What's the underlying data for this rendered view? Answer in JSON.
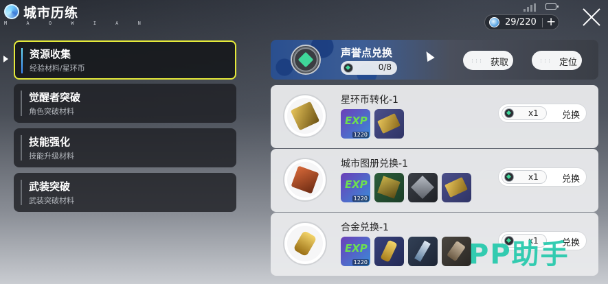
{
  "header": {
    "title": "城市历练",
    "subtitle": "M A O W I A N",
    "currency": {
      "icon": "gem-icon",
      "value": "29/220",
      "plus": "+"
    }
  },
  "menu": {
    "items": [
      {
        "label": "资源收集",
        "sub": "经验材料/星环币",
        "active": true
      },
      {
        "label": "觉醒者突破",
        "sub": "角色突破材料",
        "active": false
      },
      {
        "label": "技能强化",
        "sub": "技能升级材料",
        "active": false
      },
      {
        "label": "武装突破",
        "sub": "武装突破材料",
        "active": false
      }
    ]
  },
  "reputation": {
    "title": "声誉点兑换",
    "count": "0/8",
    "get_label": "获取",
    "locate_label": "定位",
    "dots": "⋮⋮⋮"
  },
  "exchanges": [
    {
      "title": "星环币转化-1",
      "rewards": [
        {
          "type": "exp",
          "count": "1220"
        },
        {
          "type": "ticket"
        }
      ],
      "cost": "x1",
      "button": "兑换"
    },
    {
      "title": "城市图册兑换-1",
      "rewards": [
        {
          "type": "exp",
          "count": "1220"
        },
        {
          "type": "atlas"
        },
        {
          "type": "dark"
        },
        {
          "type": "ticket"
        }
      ],
      "cost": "x1",
      "button": "兑换"
    },
    {
      "title": "合金兑换-1",
      "rewards": [
        {
          "type": "exp",
          "count": "1220"
        },
        {
          "type": "gold"
        },
        {
          "type": "crystal"
        },
        {
          "type": "stone"
        }
      ],
      "cost": "x1",
      "button": "兑换"
    }
  ],
  "exp_text": "EXP",
  "watermark": "PP助手",
  "colors": {
    "active_border": "#e5ea3a",
    "accent_green": "#3fd79a",
    "watermark": "#1ec8aa"
  }
}
